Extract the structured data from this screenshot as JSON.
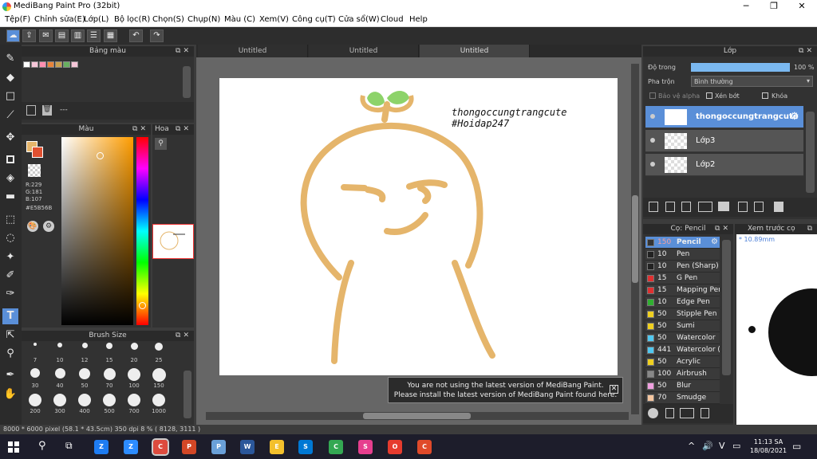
{
  "window": {
    "title": "MediBang Paint Pro (32bit)",
    "minimize": "─",
    "restore": "❐",
    "close": "✕"
  },
  "menu": [
    "Tệp(F)",
    "Chỉnh sửa(E)",
    "Lớp(L)",
    "Bộ lọc(R)",
    "Chọn(S)",
    "Chụp(N)",
    "Màu (C)",
    "Xem(V)",
    "Công cụ(T)",
    "Cửa sổ(W)",
    "Cloud",
    "Help"
  ],
  "toolbar": {
    "undo_icon": "↶",
    "redo_icon": "↷"
  },
  "palette_panel": {
    "title": "Bảng màu",
    "swatches": [
      "#ffffff",
      "#f6c6d8",
      "#ff8fb0",
      "#e8843a",
      "#c8a050",
      "#68b060",
      "#f6c6d8"
    ],
    "footer_text": "---"
  },
  "color_panel": {
    "title": "Màu",
    "r": "R:229",
    "g": "G:181",
    "b": "B:107",
    "hex": "#E5B56B",
    "foreground": "#e5b56b"
  },
  "navigator_panel": {
    "title": "Hoa"
  },
  "brush_size_panel": {
    "title": "Brush Size",
    "sizes": [
      "7",
      "10",
      "12",
      "15",
      "20",
      "25",
      "30",
      "40",
      "50",
      "70",
      "100",
      "150",
      "200",
      "300",
      "400",
      "500",
      "700",
      "1000"
    ]
  },
  "tabs": [
    "Untitled",
    "Untitled",
    "Untitled"
  ],
  "canvas": {
    "line1": "thongoccungtrangcute",
    "line2": "#Hoidap247"
  },
  "notice": {
    "line1": "You are not using the latest version of MediBang Paint.",
    "line2": "Please install the latest version of MediBang Paint found here.",
    "close": "✕"
  },
  "layer_panel": {
    "title": "Lớp",
    "opacity_label": "Độ trong",
    "opacity_value": "100 %",
    "opacity": 1.0,
    "blend_label": "Pha trộn",
    "blend_value": "Bình thường",
    "protect_alpha": "Bảo vệ alpha",
    "clip": "Xén bớt",
    "lock": "Khóa",
    "layers": [
      "thongoccungtrangcute",
      "Lớp3",
      "Lớp2"
    ]
  },
  "brush_panel": {
    "title": "Cọ: Pencil",
    "brushes": [
      {
        "size": "150",
        "name": "Pencil",
        "color": "#333333"
      },
      {
        "size": "10",
        "name": "Pen",
        "color": "#222222"
      },
      {
        "size": "10",
        "name": "Pen (Sharp)",
        "color": "#222222"
      },
      {
        "size": "15",
        "name": "G Pen",
        "color": "#e03030"
      },
      {
        "size": "15",
        "name": "Mapping Pen",
        "color": "#e03030"
      },
      {
        "size": "10",
        "name": "Edge Pen",
        "color": "#30b030"
      },
      {
        "size": "50",
        "name": "Stipple Pen",
        "color": "#f0d020"
      },
      {
        "size": "50",
        "name": "Sumi",
        "color": "#f0d020"
      },
      {
        "size": "50",
        "name": "Watercolor",
        "color": "#50c8f0"
      },
      {
        "size": "441",
        "name": "Watercolor (W",
        "color": "#50c8f0"
      },
      {
        "size": "50",
        "name": "Acrylic",
        "color": "#f0d020"
      },
      {
        "size": "100",
        "name": "Airbrush",
        "color": "#888888"
      },
      {
        "size": "50",
        "name": "Blur",
        "color": "#f0a0e0"
      },
      {
        "size": "70",
        "name": "Smudge",
        "color": "#f6c6a0"
      }
    ]
  },
  "preview_panel": {
    "title": "Xem trước cọ",
    "size": "10.89mm"
  },
  "status": {
    "text": "8000 * 6000 pixel  (58.1 * 43.5cm)  350 dpi  8 %  ( 8128, 3111 )"
  },
  "taskbar": {
    "time": "11:13 SA",
    "date": "18/08/2021",
    "lang": "V",
    "apps": [
      "Zalo",
      "Zoom",
      "Chrome",
      "PowerPoint",
      "Paint",
      "Word",
      "Explorer",
      "Store",
      "Chrome",
      "Sketch",
      "Opera",
      "Chrome"
    ]
  }
}
